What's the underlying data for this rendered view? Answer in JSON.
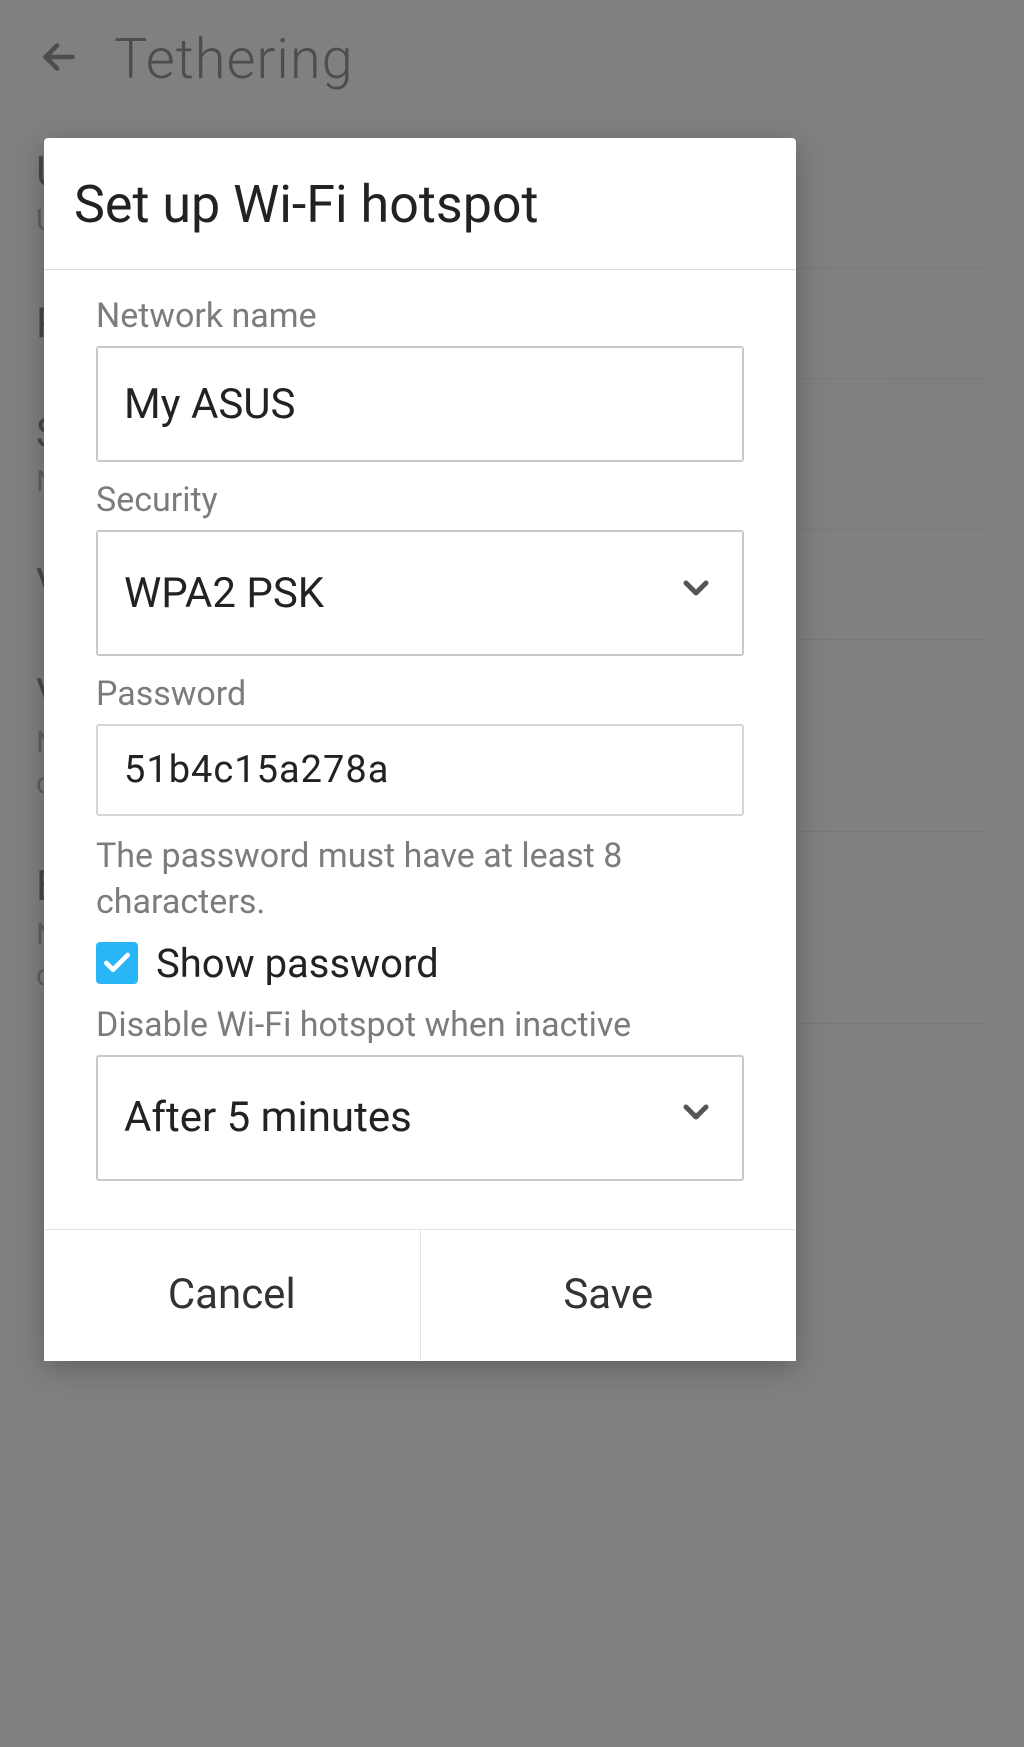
{
  "page": {
    "title": "Tethering"
  },
  "bg_items": [
    {
      "title": "U",
      "sub": "U"
    },
    {
      "title": "P",
      "sub": ""
    },
    {
      "title": "S",
      "sub": "N"
    },
    {
      "title": "V",
      "sub": ""
    },
    {
      "title": "V",
      "sub": "N\nc"
    },
    {
      "title": "E",
      "sub": "N\nc"
    }
  ],
  "dialog": {
    "title": "Set up Wi-Fi hotspot",
    "network_name_label": "Network name",
    "network_name_value": "My ASUS",
    "security_label": "Security",
    "security_value": "WPA2 PSK",
    "password_label": "Password",
    "password_value": "51b4c15a278a",
    "password_helper": "The password must have at least 8 characters.",
    "show_password_label": "Show password",
    "show_password_checked": true,
    "inactive_label": "Disable Wi-Fi hotspot when inactive",
    "inactive_value": "After 5 minutes",
    "cancel_label": "Cancel",
    "save_label": "Save"
  }
}
